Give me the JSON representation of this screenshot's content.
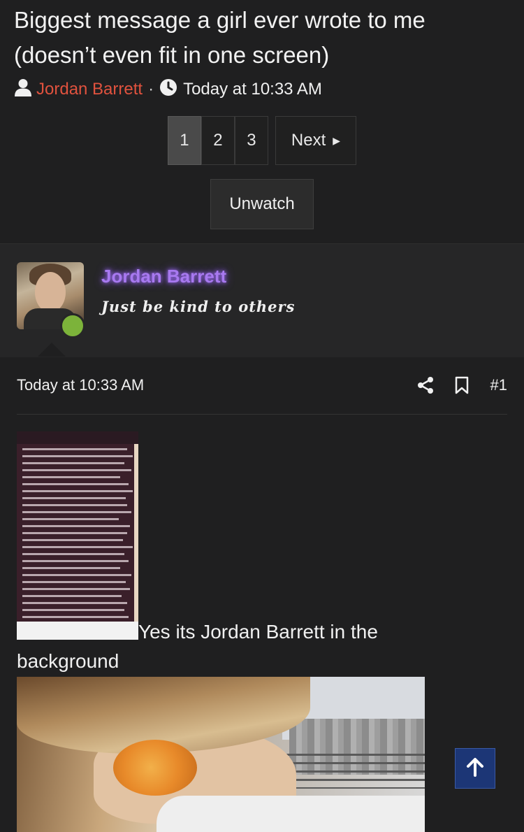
{
  "thread": {
    "title": "Biggest message a girl ever wrote to me (doesn’t even fit in one screen)",
    "author": "Jordan Barrett",
    "separator": "·",
    "time": "Today at 10:33 AM"
  },
  "pagination": {
    "pages": [
      "1",
      "2",
      "3"
    ],
    "current": "1",
    "next_label": "Next"
  },
  "watch_label": "Unwatch",
  "user": {
    "name": "Jordan Barrett",
    "title": "Just be kind to others",
    "online": true
  },
  "post": {
    "time": "Today at 10:33 AM",
    "number": "#1",
    "caption_part1": "Yes its Jordan Barrett in the",
    "caption_part2": "background"
  },
  "colors": {
    "author_link": "#e0523e",
    "username": "#a879f0",
    "online": "#7cb33a",
    "to_top": "#1c3676"
  },
  "icons": [
    "user-icon",
    "clock-icon",
    "caret-right-icon",
    "share-icon",
    "bookmark-icon",
    "arrow-up-icon"
  ]
}
